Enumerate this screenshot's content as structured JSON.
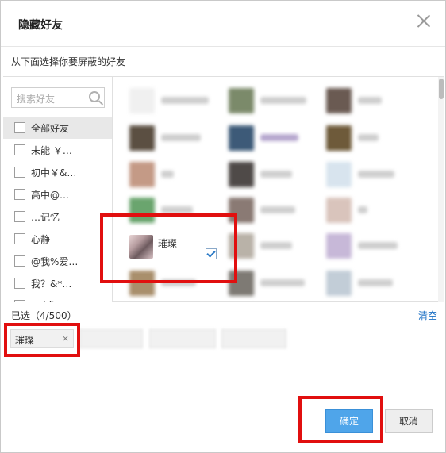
{
  "dialog": {
    "title": "隐藏好友",
    "subtitle": "从下面选择你要屏蔽的好友"
  },
  "search": {
    "placeholder": "搜索好友"
  },
  "groups": [
    {
      "label": "全部好友",
      "selected": true
    },
    {
      "label": "未能 ￥…",
      "selected": false
    },
    {
      "label": "初中￥&…",
      "selected": false
    },
    {
      "label": "高中@…",
      "selected": false
    },
    {
      "label": "…记忆",
      "selected": false
    },
    {
      "label": "心静",
      "selected": false
    },
    {
      "label": "@我%爱…",
      "selected": false
    },
    {
      "label": "我？&*…",
      "selected": false
    },
    {
      "label": "…+&…",
      "selected": false
    }
  ],
  "friend": {
    "name": "璀璨",
    "checked": true
  },
  "selected_summary": {
    "label": "已选（4/500）",
    "clear": "清空"
  },
  "selected_tags": [
    {
      "label": "璀璨",
      "remove_icon": "×"
    }
  ],
  "buttons": {
    "confirm": "确定",
    "cancel": "取消"
  },
  "colors": {
    "accent": "#4fa5ea",
    "link": "#1a6fc4",
    "highlight_box": "#e10f0f"
  },
  "icons": {
    "close": "close-icon",
    "search": "search-icon",
    "check": "checkmark-icon",
    "remove": "remove-icon"
  }
}
